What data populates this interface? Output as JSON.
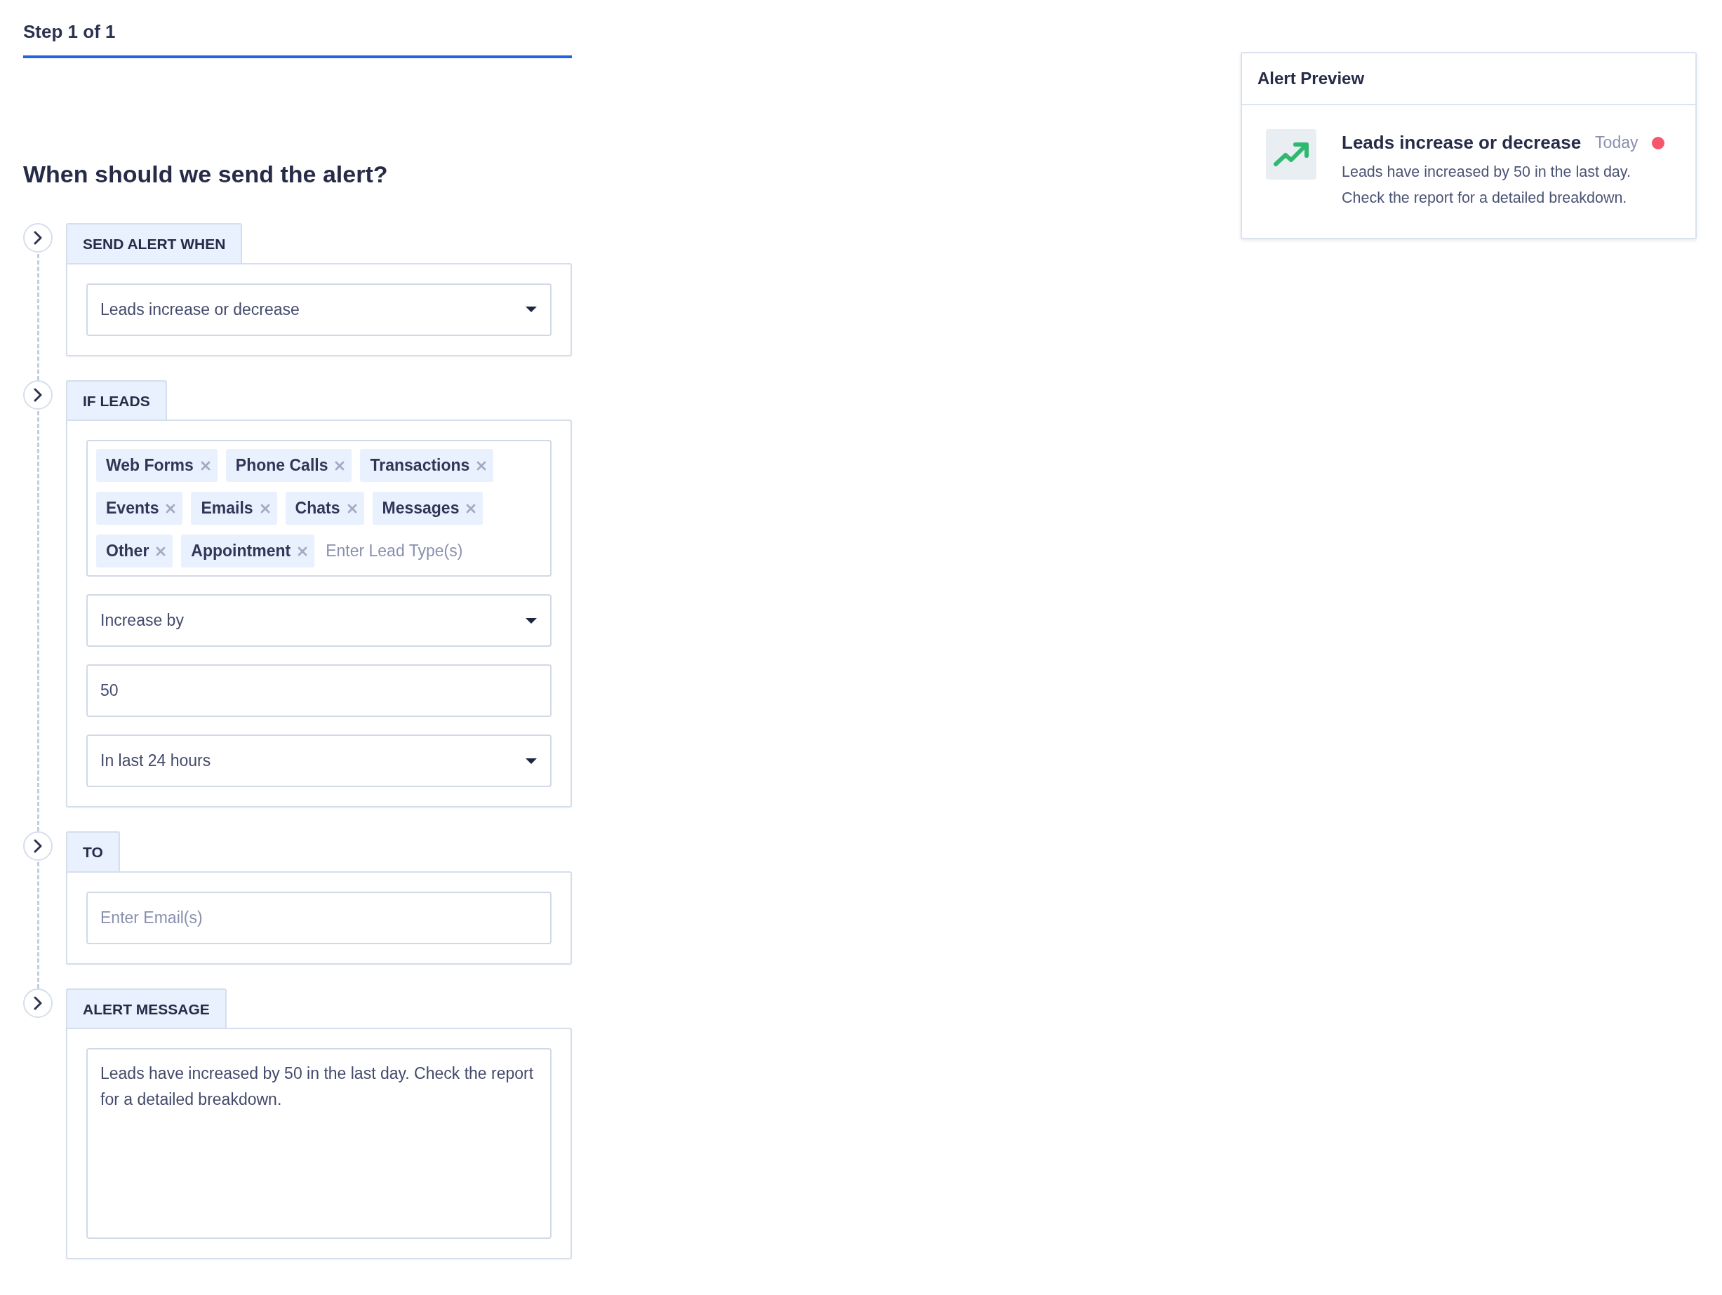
{
  "progress": {
    "label": "Step 1 of 1"
  },
  "heading": "When should we send the alert?",
  "sections": [
    {
      "title": "SEND ALERT WHEN",
      "fields": [
        {
          "kind": "select",
          "value": "Leads increase or decrease"
        }
      ]
    },
    {
      "title": "IF LEADS",
      "fields": [
        {
          "kind": "tags",
          "tags": [
            "Web Forms",
            "Phone Calls",
            "Transactions",
            "Events",
            "Emails",
            "Chats",
            "Messages",
            "Other",
            "Appointment"
          ],
          "placeholder": "Enter Lead Type(s)"
        },
        {
          "kind": "select",
          "value": "Increase by"
        },
        {
          "kind": "input",
          "value": "50"
        },
        {
          "kind": "select",
          "value": "In last 24 hours"
        }
      ]
    },
    {
      "title": "TO",
      "fields": [
        {
          "kind": "input",
          "placeholder": "Enter Email(s)"
        }
      ]
    },
    {
      "title": "ALERT MESSAGE",
      "fields": [
        {
          "kind": "textarea",
          "value": "Leads have increased by 50 in the last day. Check the report for a detailed breakdown."
        }
      ]
    }
  ],
  "preview": {
    "title": "Alert Preview",
    "alert": {
      "title": "Leads increase or decrease",
      "time": "Today",
      "unread": true,
      "message_lines": [
        "Leads have increased by 50 in the last day.",
        "Check the report for a detailed breakdown."
      ]
    }
  }
}
